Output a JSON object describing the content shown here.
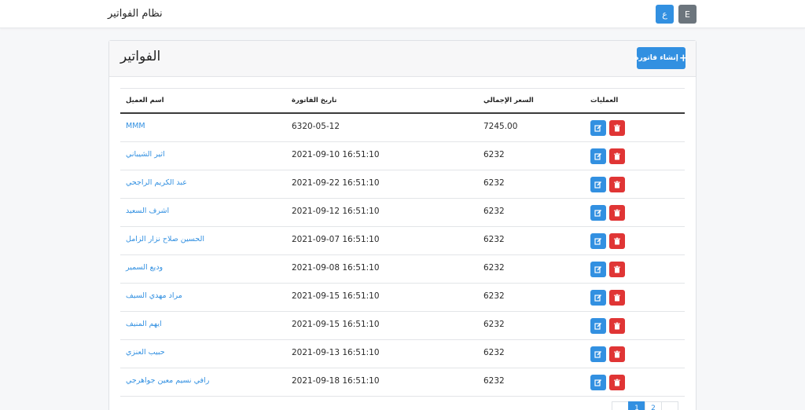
{
  "navbar": {
    "brand": "نظام الفواتير",
    "lang_ar": "ع",
    "lang_en": "E"
  },
  "invoices": {
    "title": "الفواتير",
    "create_button": "إنشاء فاتورة",
    "columns": {
      "name": "اسم العميل",
      "date": "تاريخ الفاتورة",
      "price": "السعر الإجمالي",
      "actions": "العمليات"
    },
    "rows": [
      {
        "name": "MMM",
        "date": "6320-05-12",
        "price": "7245.00"
      },
      {
        "name": "اثير الشيباني",
        "date": "2021-09-10 16:51:10",
        "price": "6232"
      },
      {
        "name": "عبد الكريم الراجحي",
        "date": "2021-09-22 16:51:10",
        "price": "6232"
      },
      {
        "name": "اشرف السعيد",
        "date": "2021-09-12 16:51:10",
        "price": "6232"
      },
      {
        "name": "الحسين صلاح نزار الزامل",
        "date": "2021-09-07 16:51:10",
        "price": "6232"
      },
      {
        "name": "وديع السمير",
        "date": "2021-09-08 16:51:10",
        "price": "6232"
      },
      {
        "name": "مراد مهدي السيف",
        "date": "2021-09-15 16:51:10",
        "price": "6232"
      },
      {
        "name": "ايهم المنيف",
        "date": "2021-09-15 16:51:10",
        "price": "6232"
      },
      {
        "name": "حبيب العنزي",
        "date": "2021-09-13 16:51:10",
        "price": "6232"
      },
      {
        "name": "رافي نسيم معين جواهرجي",
        "date": "2021-09-18 16:51:10",
        "price": "6232"
      }
    ]
  },
  "pagination": {
    "pages": [
      "1",
      "2"
    ],
    "active": "1"
  },
  "icons": {
    "plus": "plus-icon",
    "edit": "edit-icon",
    "delete": "trash-icon"
  },
  "colors": {
    "primary": "#3290e1",
    "danger": "#e03535",
    "secondary": "#6c757d"
  }
}
